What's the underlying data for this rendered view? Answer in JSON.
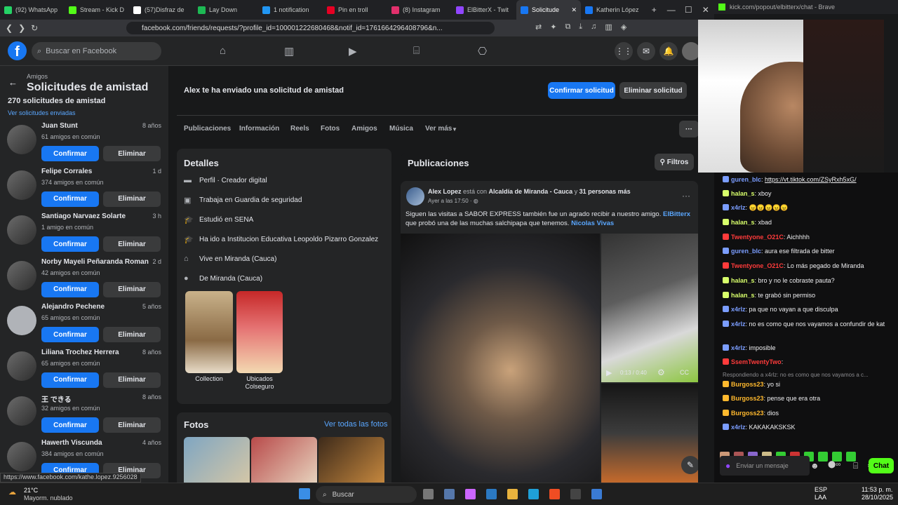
{
  "tabs": [
    {
      "label": "(92) WhatsApp",
      "color": "#25d366"
    },
    {
      "label": "Stream - Kick D",
      "color": "#53fc18"
    },
    {
      "label": "(57)Disfraz de",
      "color": "#fff"
    },
    {
      "label": "Lay Down",
      "color": "#1db954"
    },
    {
      "label": "1 notification",
      "color": "#2196f3"
    },
    {
      "label": "Pin en troll",
      "color": "#e60023"
    },
    {
      "label": "(8) Instagram",
      "color": "#e1306c"
    },
    {
      "label": "ElBitterX - Twit",
      "color": "#9146ff"
    },
    {
      "label": "Solicitude",
      "color": "#1877f2"
    },
    {
      "label": "Katherin López",
      "color": "#1877f2"
    }
  ],
  "url": "facebook.com/friends/requests/?profile_id=100001222680468&notif_id=1761664296408796&n...",
  "kick_url": "kick.com/popout/elbitterx/chat - Brave",
  "fb": {
    "search_placeholder": "Buscar en Facebook"
  },
  "left": {
    "crumb": "Amigos",
    "title": "Solicitudes de amistad",
    "count": "270 solicitudes de amistad",
    "sent_link": "Ver solicitudes enviadas",
    "confirm": "Confirmar",
    "delete": "Eliminar",
    "requests": [
      {
        "name": "Juan Stunt",
        "time": "8 años",
        "mutual": "61 amigos en común"
      },
      {
        "name": "Felipe Corrales",
        "time": "1 d",
        "mutual": "374 amigos en común"
      },
      {
        "name": "Santiago Narvaez Solarte",
        "time": "3 h",
        "mutual": "1 amigo en común"
      },
      {
        "name": "Norby Mayeli Peñaranda Roman",
        "time": "2 d",
        "mutual": "42 amigos en común"
      },
      {
        "name": "Alejandro Pechene",
        "time": "5 años",
        "mutual": "65 amigos en común"
      },
      {
        "name": "Liliana Trochez Herrera",
        "time": "8 años",
        "mutual": "65 amigos en común"
      },
      {
        "name": "王 できる",
        "time": "8 años",
        "mutual": "32 amigos en común"
      },
      {
        "name": "Hawerth Viscunda",
        "time": "4 años",
        "mutual": "384 amigos en común"
      }
    ]
  },
  "profile": {
    "request_text": "Alex te ha enviado una solicitud de amistad",
    "confirm_btn": "Confirmar solicitud",
    "delete_btn": "Eliminar solicitud",
    "tabs": [
      "Publicaciones",
      "Información",
      "Reels",
      "Fotos",
      "Amigos",
      "Música",
      "Ver más"
    ],
    "details_title": "Detalles",
    "details": [
      {
        "icon": "page-icon",
        "text": "Perfil · Creador digital"
      },
      {
        "icon": "briefcase-icon",
        "text": "Trabaja en Guardia de seguridad"
      },
      {
        "icon": "education-icon",
        "text": "Estudió en SENA"
      },
      {
        "icon": "education-icon",
        "text": "Ha ido a Institucion Educativa Leopoldo Pizarro Gonzalez"
      },
      {
        "icon": "home-icon",
        "text": "Vive en Miranda (Cauca)"
      },
      {
        "icon": "location-icon",
        "text": "De Miranda (Cauca)"
      }
    ],
    "featured": [
      {
        "label": "Collection"
      },
      {
        "label": "Ubicados Colseguro"
      }
    ],
    "photos_title": "Fotos",
    "photos_link": "Ver todas las fotos",
    "posts_title": "Publicaciones",
    "filters": "Filtros",
    "post": {
      "author": "Alex Lopez",
      "with": " está con ",
      "place": "Alcaldía de Miranda - Cauca",
      "and": " y ",
      "others": "31 personas más",
      "time": "Ayer a las 17:50 · ",
      "text": "Siguen las visitas a SABOR EXPRESS también fue un agrado recibir a nuestro amigo. ",
      "tag1": "ElBitterx",
      "text2": " que probó una de las muchas salchipapa que tenemos. ",
      "tag2": "Nicolas Vivas",
      "video_time": "0:13 / 0:40"
    }
  },
  "status_url": "https://www.facebook.com/kathe.lopez.9256028",
  "chat": {
    "messages": [
      {
        "user": "guren_blc",
        "color": "#7b9dff",
        "text": "https://vt.tiktok.com/ZSyRxh5xG/"
      },
      {
        "user": "halan_s",
        "color": "#d8ff6b",
        "text": "xboy"
      },
      {
        "user": "x4rlz",
        "color": "#7b9dff",
        "text": "😠😠😠😠😠"
      },
      {
        "user": "halan_s",
        "color": "#d8ff6b",
        "text": "xbad"
      },
      {
        "user": "Twentyone_O21C",
        "color": "#ff3b3b",
        "text": "Aichhhh"
      },
      {
        "user": "guren_blc",
        "color": "#7b9dff",
        "text": "aura ese filtrada de bitter"
      },
      {
        "user": "Twentyone_O21C",
        "color": "#ff3b3b",
        "text": "Lo más pegado de Miranda"
      },
      {
        "user": "halan_s",
        "color": "#d8ff6b",
        "text": "bro y no le cobraste pauta?"
      },
      {
        "user": "halan_s",
        "color": "#d8ff6b",
        "text": "te grabó sin permiso"
      },
      {
        "user": "x4rlz",
        "color": "#7b9dff",
        "text": "pa que no vayan a que disculpa"
      },
      {
        "user": "x4rlz",
        "color": "#7b9dff",
        "text": "no es como que nos vayamos a confundir de kat"
      },
      {
        "user": "x4rlz",
        "color": "#7b9dff",
        "text": "imposible"
      },
      {
        "user": "SsemTwentyTwo",
        "color": "#ff3b3b",
        "text": ""
      },
      {
        "user": "Burgoss23",
        "color": "#ffb92e",
        "text": "yo si"
      },
      {
        "user": "Burgoss23",
        "color": "#ffb92e",
        "text": "pense que era otra"
      },
      {
        "user": "Burgoss23",
        "color": "#ffb92e",
        "text": "dios"
      },
      {
        "user": "x4rlz",
        "color": "#7b9dff",
        "text": "KAKAKAKSKSK"
      }
    ],
    "reply_note": "Respondiendo a x4rlz: no es como que nos vayamos a c...",
    "placeholder": "Enviar un mensaje",
    "send": "Chat"
  },
  "taskbar": {
    "temp": "21°C",
    "weather": "Mayorm. nublado",
    "search": "Buscar",
    "lang": "ESP",
    "lang2": "LAA",
    "time": "11:53 p. m.",
    "date": "28/10/2025"
  }
}
